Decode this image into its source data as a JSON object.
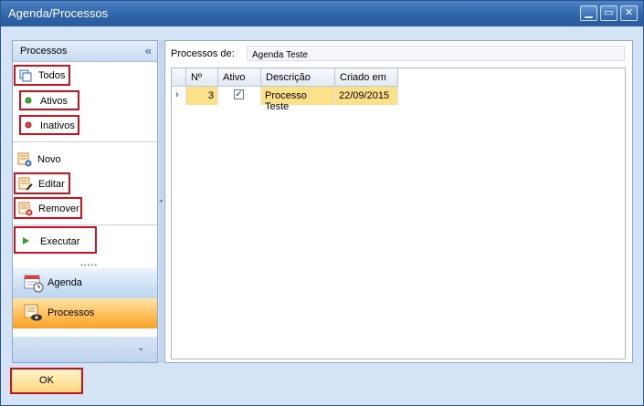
{
  "window": {
    "title": "Agenda/Processos",
    "minimize_icon": "minimize-icon",
    "maximize_icon": "maximize-icon",
    "close_icon": "close-icon"
  },
  "nav": {
    "header": "Processos",
    "collapse_icon": "double-chevron-left-icon",
    "filters": [
      {
        "label": "Todos",
        "icon": "list-icon"
      },
      {
        "label": "Ativos",
        "icon": "green-dot-icon"
      },
      {
        "label": "Inativos",
        "icon": "red-dot-icon"
      }
    ],
    "actions": [
      {
        "label": "Novo",
        "icon": "document-add-icon"
      },
      {
        "label": "Editar",
        "icon": "document-edit-icon"
      },
      {
        "label": "Remover",
        "icon": "document-remove-icon"
      }
    ],
    "run": {
      "label": "Executar",
      "icon": "play-icon"
    },
    "buttons": [
      {
        "label": "Agenda",
        "icon": "calendar-icon"
      },
      {
        "label": "Processos",
        "icon": "process-icon",
        "selected": true
      }
    ],
    "expand_icon": "chevron-down-icon"
  },
  "content": {
    "label": "Processos de:",
    "value": "Agenda Teste",
    "grid": {
      "columns": [
        "Nº",
        "Ativo",
        "Descrição",
        "Criado em"
      ],
      "rows": [
        {
          "num": "3",
          "ativo": true,
          "descricao": "Processo Teste",
          "criado": "22/09/2015"
        }
      ]
    }
  },
  "ok_label": "OK",
  "colors": {
    "highlight_border": "#d0101f",
    "selected_row": "#fde08a",
    "titlebar": "#2d63a8"
  }
}
